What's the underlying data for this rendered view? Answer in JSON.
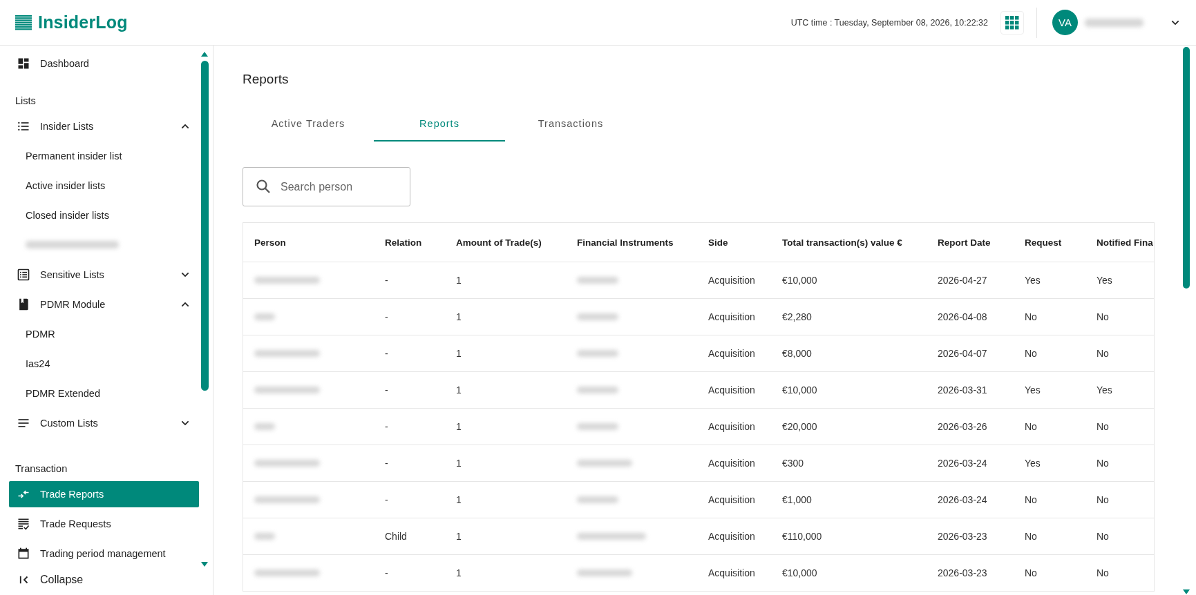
{
  "header": {
    "logo": "InsiderLog",
    "utc_time": "UTC time : Tuesday, September 08, 2026, 10:22:32",
    "avatar": "VA"
  },
  "sidebar": {
    "items": [
      {
        "kind": "nav",
        "label": "Dashboard",
        "selected": false
      },
      {
        "kind": "heading",
        "label": "Lists"
      },
      {
        "kind": "nav",
        "label": "Insider Lists",
        "selected": false,
        "expanded": true
      },
      {
        "kind": "sub",
        "label": "Permanent insider list",
        "selected": false
      },
      {
        "kind": "sub",
        "label": "Active insider lists",
        "selected": false
      },
      {
        "kind": "sub",
        "label": "Closed insider lists",
        "selected": false
      },
      {
        "kind": "redacted"
      },
      {
        "kind": "nav",
        "label": "Sensitive Lists",
        "selected": false,
        "expanded": false
      },
      {
        "kind": "nav",
        "label": "PDMR Module",
        "selected": false,
        "expanded": true
      },
      {
        "kind": "sub",
        "label": "PDMR",
        "selected": false
      },
      {
        "kind": "sub",
        "label": "Ias24",
        "selected": false
      },
      {
        "kind": "sub",
        "label": "PDMR Extended",
        "selected": false
      },
      {
        "kind": "nav",
        "label": "Custom Lists",
        "selected": false,
        "expanded": false
      },
      {
        "kind": "heading",
        "label": "Transaction"
      },
      {
        "kind": "nav",
        "label": "Trade Reports",
        "selected": true
      },
      {
        "kind": "nav",
        "label": "Trade Requests",
        "selected": false
      },
      {
        "kind": "nav",
        "label": "Trading period management",
        "selected": false
      }
    ],
    "collapse": "Collapse"
  },
  "page_title": "Reports",
  "tabs": [
    {
      "label": "Active Traders",
      "selected": false
    },
    {
      "label": "Reports",
      "selected": true
    },
    {
      "label": "Transactions",
      "selected": false
    }
  ],
  "search": {
    "placeholder": "Search person"
  },
  "table": {
    "columns": [
      "Person",
      "Relation",
      "Amount of Trade(s)",
      "Financial Instruments",
      "Side",
      "Total transaction(s) value €",
      "Report Date",
      "Request",
      "Notified Fina"
    ],
    "rows": [
      {
        "relation": "-",
        "amount": "1",
        "side": "Acquisition",
        "total": "€10,000",
        "report_date": "2026-04-27",
        "request": "Yes",
        "notified": "Yes"
      },
      {
        "relation": "-",
        "amount": "1",
        "side": "Acquisition",
        "total": "€2,280",
        "report_date": "2026-04-08",
        "request": "No",
        "notified": "No"
      },
      {
        "relation": "-",
        "amount": "1",
        "side": "Acquisition",
        "total": "€8,000",
        "report_date": "2026-04-07",
        "request": "No",
        "notified": "No"
      },
      {
        "relation": "-",
        "amount": "1",
        "side": "Acquisition",
        "total": "€10,000",
        "report_date": "2026-03-31",
        "request": "Yes",
        "notified": "Yes"
      },
      {
        "relation": "-",
        "amount": "1",
        "side": "Acquisition",
        "total": "€20,000",
        "report_date": "2026-03-26",
        "request": "No",
        "notified": "No"
      },
      {
        "relation": "-",
        "amount": "1",
        "side": "Acquisition",
        "total": "€300",
        "report_date": "2026-03-24",
        "request": "Yes",
        "notified": "No"
      },
      {
        "relation": "-",
        "amount": "1",
        "side": "Acquisition",
        "total": "€1,000",
        "report_date": "2026-03-24",
        "request": "No",
        "notified": "No"
      },
      {
        "relation": "Child",
        "amount": "1",
        "side": "Acquisition",
        "total": "€110,000",
        "report_date": "2026-03-23",
        "request": "No",
        "notified": "No"
      },
      {
        "relation": "-",
        "amount": "1",
        "side": "Acquisition",
        "total": "€10,000",
        "report_date": "2026-03-23",
        "request": "No",
        "notified": "No"
      }
    ]
  }
}
